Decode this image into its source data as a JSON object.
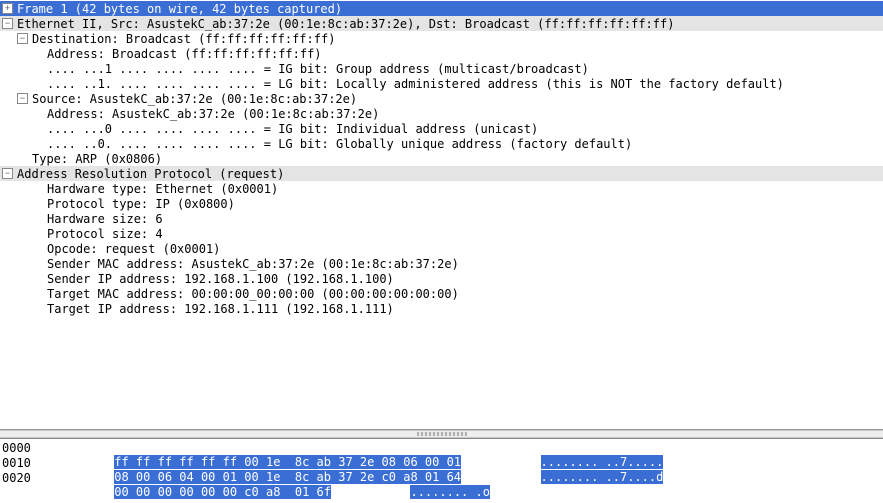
{
  "tree": {
    "frame": {
      "label": "Frame 1 (42 bytes on wire, 42 bytes captured)",
      "expander": "plus"
    },
    "eth": {
      "label": "Ethernet II, Src: AsustekC_ab:37:2e (00:1e:8c:ab:37:2e), Dst: Broadcast (ff:ff:ff:ff:ff:ff)",
      "expander": "minus",
      "dst": {
        "label": "Destination: Broadcast (ff:ff:ff:ff:ff:ff)",
        "expander": "minus",
        "address": "Address: Broadcast (ff:ff:ff:ff:ff:ff)",
        "ig_bit": ".... ...1 .... .... .... .... = IG bit: Group address (multicast/broadcast)",
        "lg_bit": ".... ..1. .... .... .... .... = LG bit: Locally administered address (this is NOT the factory default)"
      },
      "src": {
        "label": "Source: AsustekC_ab:37:2e (00:1e:8c:ab:37:2e)",
        "expander": "minus",
        "address": "Address: AsustekC_ab:37:2e (00:1e:8c:ab:37:2e)",
        "ig_bit": ".... ...0 .... .... .... .... = IG bit: Individual address (unicast)",
        "lg_bit": ".... ..0. .... .... .... .... = LG bit: Globally unique address (factory default)"
      },
      "type": "Type: ARP (0x0806)"
    },
    "arp": {
      "label": "Address Resolution Protocol (request)",
      "expander": "minus",
      "hw_type": "Hardware type: Ethernet (0x0001)",
      "proto_type": "Protocol type: IP (0x0800)",
      "hw_size": "Hardware size: 6",
      "proto_size": "Protocol size: 4",
      "opcode": "Opcode: request (0x0001)",
      "sender_mac": "Sender MAC address: AsustekC_ab:37:2e (00:1e:8c:ab:37:2e)",
      "sender_ip": "Sender IP address: 192.168.1.100 (192.168.1.100)",
      "target_mac": "Target MAC address: 00:00:00_00:00:00 (00:00:00:00:00:00)",
      "target_ip": "Target IP address: 192.168.1.111 (192.168.1.111)"
    }
  },
  "hex": {
    "lines": [
      {
        "offset": "0000",
        "bytes_pre_sel": "",
        "bytes_sel": "ff ff ff ff ff ff 00 1e  8c ab 37 2e 08 06 00 01",
        "bytes_post_sel": "",
        "ascii_pre_sel": "",
        "ascii_sel": "........ ..7.....",
        "ascii_post_sel": ""
      },
      {
        "offset": "0010",
        "bytes_pre_sel": "",
        "bytes_sel": "08 00 06 04 00 01 00 1e  8c ab 37 2e c0 a8 01 64",
        "bytes_post_sel": "",
        "ascii_pre_sel": "",
        "ascii_sel": "........ ..7....d",
        "ascii_post_sel": ""
      },
      {
        "offset": "0020",
        "bytes_pre_sel": "",
        "bytes_sel": "00 00 00 00 00 00 c0 a8  01 6f",
        "bytes_post_sel": "",
        "ascii_pre_sel": "",
        "ascii_sel": "........ .o",
        "ascii_post_sel": ""
      }
    ]
  }
}
